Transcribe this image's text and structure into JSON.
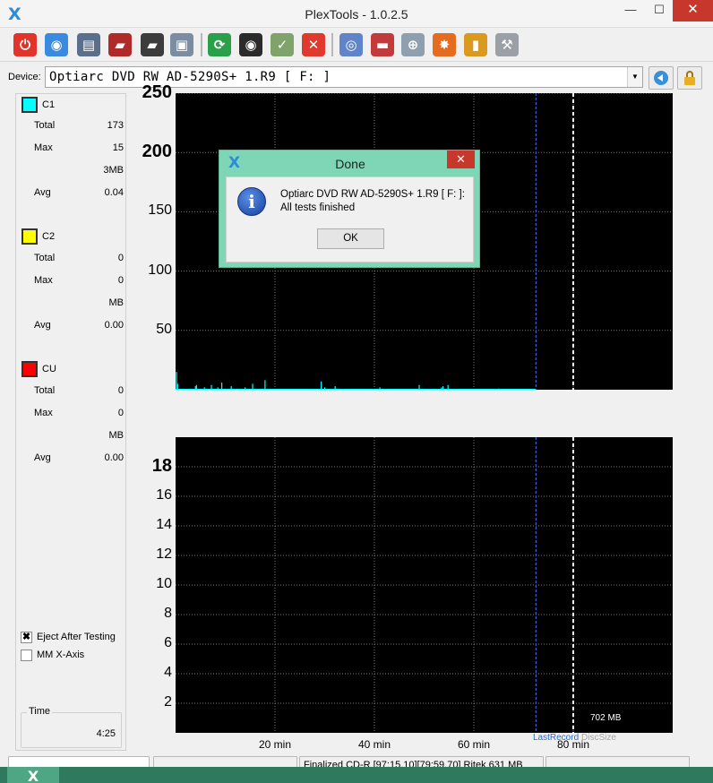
{
  "window": {
    "title": "PlexTools - 1.0.2.5",
    "logo": "X",
    "minimize": "—",
    "maximize": "☐",
    "close": "✕"
  },
  "toolbar": {
    "buttons": [
      {
        "name": "power-icon",
        "glyph": "⏻",
        "color": "#e2342a"
      },
      {
        "name": "drive-info-icon",
        "glyph": "◉",
        "color": "#3a8be0"
      },
      {
        "name": "disc-drive-icon",
        "glyph": "▤",
        "color": "#5a6f8c"
      },
      {
        "name": "disc-info-icon",
        "glyph": "▰",
        "color": "#b02a2a"
      },
      {
        "name": "settings-disk-icon",
        "glyph": "▰",
        "color": "#3c3c3c"
      },
      {
        "name": "copy-icon",
        "glyph": "▣",
        "color": "#7c8da3"
      },
      {
        "name": "refresh-icon",
        "glyph": "⟳",
        "color": "#2aa04a"
      },
      {
        "name": "scan-disc-icon",
        "glyph": "◉",
        "color": "#2b2b2b"
      },
      {
        "name": "test-write-icon",
        "glyph": "✓",
        "color": "#7fa36b"
      },
      {
        "name": "stop-icon",
        "glyph": "✕",
        "color": "#e03a2e"
      },
      {
        "name": "cd-icon",
        "glyph": "◎",
        "color": "#5f84c8"
      },
      {
        "name": "hdd-icon",
        "glyph": "▬",
        "color": "#c33a3a"
      },
      {
        "name": "network-icon",
        "glyph": "⊕",
        "color": "#8ea0b0"
      },
      {
        "name": "burn-icon",
        "glyph": "✸",
        "color": "#e56b1f"
      },
      {
        "name": "chart-icon",
        "glyph": "▮",
        "color": "#d99a1f"
      },
      {
        "name": "tool-icon",
        "glyph": "⚒",
        "color": "#9aa0a6"
      }
    ]
  },
  "device": {
    "label": "Device:",
    "value": "Optiarc  DVD RW AD-5290S+ 1.R9 [ F: ]",
    "arrow": "▼"
  },
  "stats": {
    "c1": {
      "name": "C1",
      "color": "#00ffff",
      "total_label": "Total",
      "total": "173",
      "max_label": "Max",
      "max": "15",
      "unit": "3MB",
      "avg_label": "Avg",
      "avg": "0.04"
    },
    "c2": {
      "name": "C2",
      "color": "#ffff00",
      "total_label": "Total",
      "total": "0",
      "max_label": "Max",
      "max": "0",
      "unit": "MB",
      "avg_label": "Avg",
      "avg": "0.00"
    },
    "cu": {
      "name": "CU",
      "color": "#ff0000",
      "total_label": "Total",
      "total": "0",
      "max_label": "Max",
      "max": "0",
      "unit": "MB",
      "avg_label": "Avg",
      "avg": "0.00"
    }
  },
  "options": {
    "eject_label": "Eject After Testing",
    "eject_checked": true,
    "mm_label": "MM X-Axis",
    "mm_checked": false
  },
  "time": {
    "label": "Time",
    "value": "4:25"
  },
  "chart_data": [
    {
      "type": "bar",
      "name": "C1",
      "yticks": [
        "250",
        "200",
        "150",
        "100",
        "50"
      ],
      "ylim": [
        0,
        250
      ],
      "xlim": [
        0,
        100
      ],
      "x": [
        0.2,
        0.4,
        4.0,
        4.2,
        5.8,
        7.2,
        8.5,
        9.3,
        11.2,
        14.0,
        15.5,
        18.0,
        29.3,
        30.0,
        32.1,
        41.1,
        49.0,
        53.5,
        53.8,
        54.8,
        65.0
      ],
      "values": [
        15,
        5,
        3,
        4,
        2,
        4,
        2,
        6,
        3,
        2,
        5,
        8,
        7,
        2,
        3,
        2,
        4,
        2,
        3,
        4,
        1
      ],
      "series_color": "#00ffff",
      "markers": {
        "last_record": 72.5,
        "disc_size": 80.0
      }
    },
    {
      "type": "bar",
      "name": "C2",
      "yticks": [
        "18",
        "16",
        "14",
        "12",
        "10",
        "8",
        "6",
        "4",
        "2"
      ],
      "ylim": [
        0,
        20
      ],
      "xlim": [
        0,
        100
      ],
      "values": [],
      "markers": {
        "last_record": 72.5,
        "disc_size": 80.0
      }
    }
  ],
  "x_axis": {
    "ticks": [
      "20 min",
      "40 min",
      "60 min",
      "80 min"
    ],
    "tick_values": [
      20,
      40,
      60,
      80
    ],
    "last_record_label": "LastRecord",
    "disc_size_label": "DiscSize",
    "size_label": "702 MB"
  },
  "dialog": {
    "logo": "X",
    "title": "Done",
    "close": "✕",
    "icon": "i",
    "line1": "Optiarc  DVD RW AD-5290S+ 1.R9 [ F: ]:",
    "line2": "All tests finished",
    "ok": "OK"
  },
  "statusbar": {
    "cell2": "",
    "cell3": "Finalized   CD-R   [97:15.10][79:59.70] Ritek   631 MB",
    "cell4": ""
  },
  "taskbar": {
    "item": "X"
  }
}
